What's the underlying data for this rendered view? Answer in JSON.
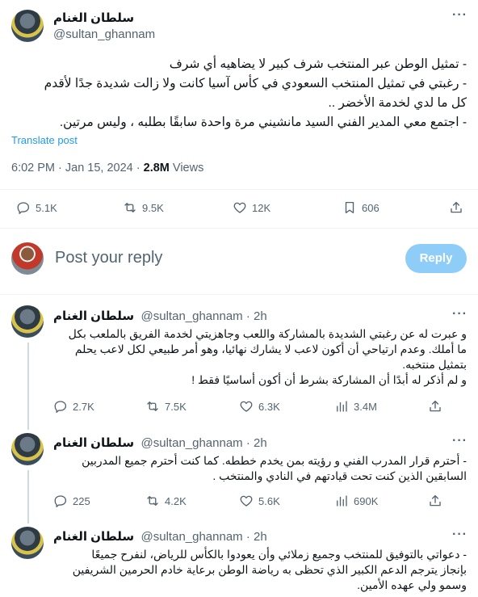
{
  "main_tweet": {
    "author_name": "سلطان الغنام",
    "author_handle": "@sultan_ghannam",
    "lines": [
      "- تمثيل الوطن عبر المنتخب شرف كبير لا يضاهيه أي شرف",
      "- رغبتي في تمثيل المنتخب السعودي في كأس آسيا كانت ولا زالت شديدة جدًا لأقدم",
      "كل ما لدي لخدمة الأخضر ..",
      "- اجتمع معي المدير الفني السيد مانشيني مرة واحدة سابقًا بطلبه ، وليس مرتين."
    ],
    "translate": "Translate post",
    "time": "6:02 PM · Jan 15, 2024 · ",
    "views_count": "2.8M",
    "views_label": " Views",
    "replies": "5.1K",
    "reposts": "9.5K",
    "likes": "12K",
    "bookmarks": "606"
  },
  "reply_box": {
    "placeholder": "Post your reply",
    "button": "Reply"
  },
  "replies": [
    {
      "author_name": "سلطان الغنام",
      "meta": "@sultan_ghannam · 2h",
      "lines": [
        "و عبرت له عن رغبتي الشديدة بالمشاركة واللعب وجاهزيتي لخدمة الفريق بالملعب بكل",
        "ما أملك. وعدم ارتياحي أن أكون لاعب لا يشارك نهائيا، وهو أمر طبيعي لكل لاعب يحلم",
        "بتمثيل منتخبه.",
        "و لم أذكر له أبدًا أن المشاركة بشرط أن أكون أساسيًا فقط !"
      ],
      "replies": "2.7K",
      "reposts": "7.5K",
      "likes": "6.3K",
      "views": "3.4M"
    },
    {
      "author_name": "سلطان الغنام",
      "meta": "@sultan_ghannam · 2h",
      "lines": [
        "- أحترم قرار المدرب الفني و رؤيته بمن يخدم خططه. كما كنت أحترم جميع المدربين",
        "السابقين الذين كنت تحت قيادتهم في النادي والمنتخب ."
      ],
      "replies": "225",
      "reposts": "4.2K",
      "likes": "5.6K",
      "views": "690K"
    },
    {
      "author_name": "سلطان الغنام",
      "meta": "@sultan_ghannam · 2h",
      "lines": [
        "- دعواتي بالتوفيق للمنتخب وجميع زملائي وأن يعودوا بالكأس للرياض، لنفرح جميعًا",
        "بإنجاز يترجم الدعم الكبير الذي تحظى به رياضة الوطن برعاية خادم الحرمين الشريفين",
        "وسمو ولي عهده الأمين."
      ]
    }
  ]
}
